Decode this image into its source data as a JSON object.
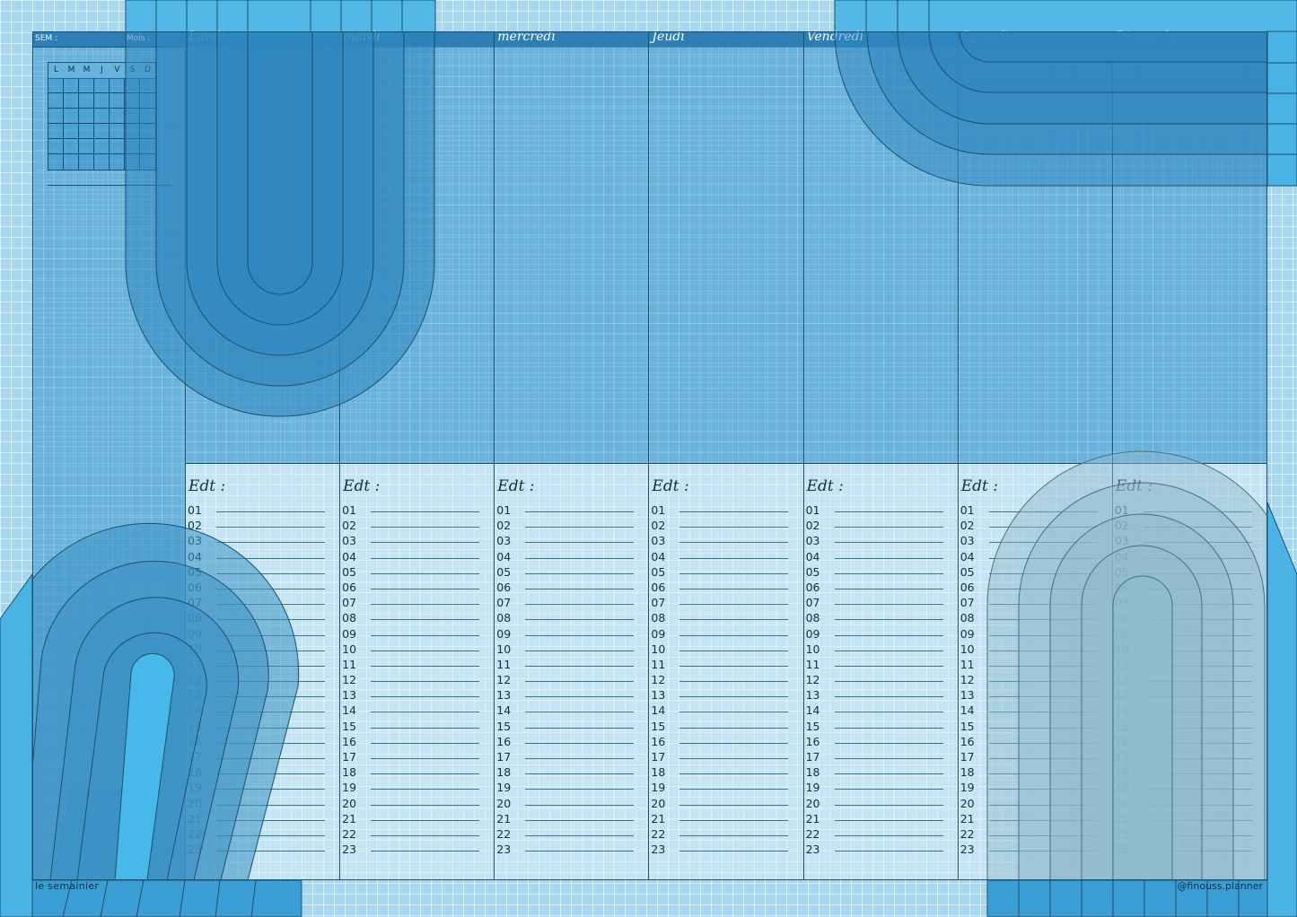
{
  "sidebar": {
    "sem_label": "SEM :",
    "mois_label": "Mois :",
    "mini_calendar_headers": [
      "L",
      "M",
      "M",
      "J",
      "V",
      "S",
      "D"
    ],
    "footer_left": "le semainier",
    "footer_right": "@finouss.planner"
  },
  "days": [
    {
      "name": "Lundi",
      "edt": "Edt :"
    },
    {
      "name": "mardi",
      "edt": "Edt :"
    },
    {
      "name": "mercredi",
      "edt": "Edt :"
    },
    {
      "name": "Jeudi",
      "edt": "Edt :"
    },
    {
      "name": "Vendredi",
      "edt": "Edt :"
    },
    {
      "name": "Samedi",
      "edt": "Edt :"
    },
    {
      "name": "Dimanche",
      "edt": "Edt :"
    }
  ],
  "hours": [
    "01",
    "02",
    "03",
    "04",
    "05",
    "06",
    "07",
    "08",
    "09",
    "10",
    "11",
    "12",
    "13",
    "14",
    "15",
    "16",
    "17",
    "18",
    "19",
    "20",
    "21",
    "22",
    "23"
  ],
  "colors": {
    "background": "#a7d6ee",
    "header": "#2d7fb5",
    "panel": "#3496cd",
    "arch": "#2f86bf",
    "line": "#1f4f6b"
  }
}
